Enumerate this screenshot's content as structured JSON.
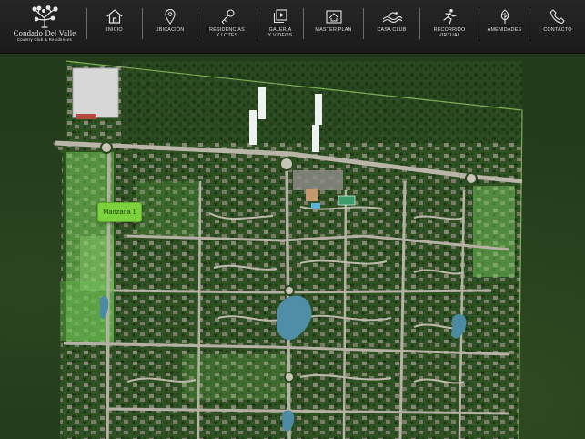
{
  "brand": {
    "name": "Condado Del Valle",
    "tagline": "Country Club & Residences"
  },
  "nav": [
    {
      "label": "INICIO",
      "icon": "home-icon"
    },
    {
      "label": "UBICACIÓN",
      "icon": "location-pin-icon"
    },
    {
      "label": "RESIDENCIAS\nY LOTES",
      "icon": "key-icon"
    },
    {
      "label": "GALERÍA\nY VIDEOS",
      "icon": "gallery-icon"
    },
    {
      "label": "MASTER PLAN",
      "icon": "master-plan-icon"
    },
    {
      "label": "CASA CLUB",
      "icon": "wave-icon"
    },
    {
      "label": "RECORRIDO\nVIRTUAL",
      "icon": "runner-icon"
    },
    {
      "label": "AMENIDADES",
      "icon": "tree-icon"
    },
    {
      "label": "CONTACTO",
      "icon": "phone-icon"
    }
  ],
  "map": {
    "pin_label": "Manzana 1"
  }
}
